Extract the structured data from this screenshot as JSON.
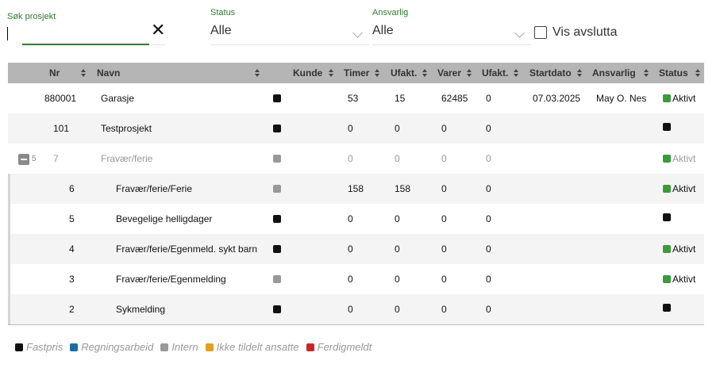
{
  "filters": {
    "search": {
      "label": "Søk prosjekt",
      "value": "",
      "clear_glyph": "✕"
    },
    "status": {
      "label": "Status",
      "value": "Alle"
    },
    "ansvarlig": {
      "label": "Ansvarlig",
      "value": "Alle"
    },
    "vis_avslutta": {
      "label": "Vis avslutta",
      "checked": false
    }
  },
  "grid": {
    "columns": [
      "Nr",
      "Navn",
      "Kunde",
      "Timer",
      "Ufakt.",
      "Varer",
      "Ufakt.",
      "Startdato",
      "Ansvarlig",
      "Status"
    ],
    "rows": [
      {
        "nr": "880001",
        "navn": "Garasje",
        "type_color": "#111111",
        "timer": "53",
        "ufakt1": "15",
        "varer": "62485",
        "ufakt2": "0",
        "startdato": "07.03.2025",
        "ansvarlig": "May O. Nes",
        "status_color": "#3a9b3a",
        "status": "Aktivt"
      },
      {
        "nr": "101",
        "navn": "Testprosjekt",
        "type_color": "#111111",
        "timer": "0",
        "ufakt1": "0",
        "varer": "0",
        "ufakt2": "0",
        "startdato": "",
        "ansvarlig": "",
        "status_color": "#111111",
        "status": ""
      },
      {
        "nr": "7",
        "navn": "Fravær/ferie",
        "type_color": "#999999",
        "timer": "0",
        "ufakt1": "0",
        "varer": "0",
        "ufakt2": "0",
        "startdato": "",
        "ansvarlig": "",
        "status_color": "#3a9b3a",
        "status": "Aktivt",
        "child_count": "5",
        "expanded": true
      },
      {
        "nr": "6",
        "navn": "Fravær/ferie/Ferie",
        "type_color": "#999999",
        "timer": "158",
        "ufakt1": "158",
        "varer": "0",
        "ufakt2": "0",
        "startdato": "",
        "ansvarlig": "",
        "status_color": "#3a9b3a",
        "status": "Aktivt"
      },
      {
        "nr": "5",
        "navn": "Bevegelige helligdager",
        "type_color": "#111111",
        "timer": "0",
        "ufakt1": "0",
        "varer": "0",
        "ufakt2": "0",
        "startdato": "",
        "ansvarlig": "",
        "status_color": "#111111",
        "status": ""
      },
      {
        "nr": "4",
        "navn": "Fravær/ferie/Egenmeld. sykt barn",
        "type_color": "#111111",
        "timer": "0",
        "ufakt1": "0",
        "varer": "0",
        "ufakt2": "0",
        "startdato": "",
        "ansvarlig": "",
        "status_color": "#3a9b3a",
        "status": "Aktivt"
      },
      {
        "nr": "3",
        "navn": "Fravær/ferie/Egenmelding",
        "type_color": "#999999",
        "timer": "0",
        "ufakt1": "0",
        "varer": "0",
        "ufakt2": "0",
        "startdato": "",
        "ansvarlig": "",
        "status_color": "#3a9b3a",
        "status": "Aktivt"
      },
      {
        "nr": "2",
        "navn": "Sykmelding",
        "type_color": "#111111",
        "timer": "0",
        "ufakt1": "0",
        "varer": "0",
        "ufakt2": "0",
        "startdato": "",
        "ansvarlig": "",
        "status_color": "#111111",
        "status": ""
      }
    ]
  },
  "legend": [
    {
      "label": "Fastpris",
      "color": "#111111"
    },
    {
      "label": "Regningsarbeid",
      "color": "#1a6fa0"
    },
    {
      "label": "Intern",
      "color": "#999999"
    },
    {
      "label": "Ikke tildelt ansatte",
      "color": "#e0a020"
    },
    {
      "label": "Ferdigmeldt",
      "color": "#c62828"
    }
  ]
}
